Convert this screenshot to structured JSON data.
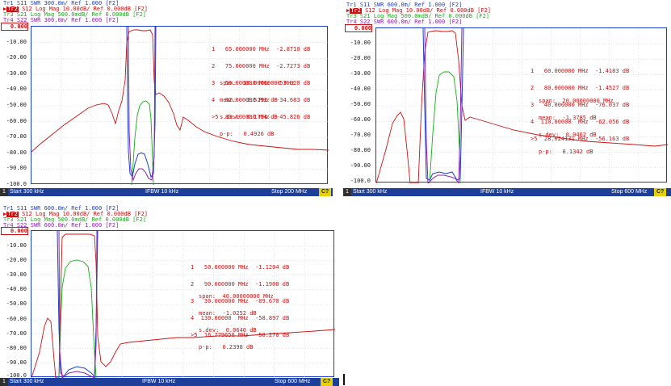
{
  "panels": [
    {
      "traces": [
        {
          "id": "Tr1",
          "text": "S11  SWR 300.0m/ Ref 1.000 [F2]",
          "color": "#1a3fd0",
          "selected": false
        },
        {
          "id": "Tr2",
          "text": "S12  Log Mag 10.00dB/ Ref 0.000dB [F2]",
          "color": "#d01010",
          "selected": true
        },
        {
          "id": "Tr3",
          "text": "S21  Log Mag 500.0mdB/ Ref 0.000dB [F2]",
          "color": "#10b010",
          "selected": false
        },
        {
          "id": "Tr4",
          "text": "S22  SWR 300.0m/ Ref 1.000 [F2]",
          "color": "#9020b0",
          "selected": false
        }
      ],
      "y_labels": [
        "0.000",
        "-10.00",
        "-20.00",
        "-30.00",
        "-40.00",
        "-50.00",
        "-60.00",
        "-70.00",
        "-80.00",
        "-90.00",
        "-100.0"
      ],
      "markers": [
        "1   65.000000 MHz  -2.8710 dB",
        "2   75.000000 MHz  -2.7273 dB",
        "3   56.000000 MHz  -53.020 dB",
        "4   82.000000 MHz  -34.683 dB",
        ">5  83.000000 MHz  -45.826 dB"
      ],
      "stats": [
        "span:  10.00000000 MHz",
        "mean:  -2.5292 dB",
        "s.dev:  0.1754 dB",
        "p-p:   0.4926 dB"
      ],
      "status": {
        "channel": "1",
        "start": "Start 300 kHz",
        "ifbw": "IFBW 10 kHz",
        "stop": "Stop 200 MHz",
        "c2": "C?"
      }
    },
    {
      "traces": [
        {
          "id": "Tr1",
          "text": "S11  SWR 600.0m/ Ref 1.000 [F2]",
          "color": "#1a3fd0",
          "selected": false
        },
        {
          "id": "Tr2",
          "text": "S12  Log Mag 10.00dB/ Ref 0.000dB [F2]",
          "color": "#d01010",
          "selected": true
        },
        {
          "id": "Tr3",
          "text": "S21  Log Mag 500.0mdB/ Ref 0.000dB [F2]",
          "color": "#10b010",
          "selected": false
        },
        {
          "id": "Tr4",
          "text": "S22  SWR 600.0m/ Ref 1.000 [F2]",
          "color": "#9020b0",
          "selected": false
        }
      ],
      "y_labels": [
        "0.000",
        "-10.00",
        "-20.00",
        "-30.00",
        "-40.00",
        "-50.00",
        "-60.00",
        "-70.00",
        "-80.00",
        "-90.00",
        "-100.0"
      ],
      "markers": [
        "1   60.000000 MHz  -1.4183 dB",
        "2   80.000000 MHz  -1.4527 dB",
        "3   40.000000 MHz  -76.037 dB",
        "4  110.00000  MHz  -62.056 dB",
        ">5  28.024131 MHz  -56.163 dB"
      ],
      "stats": [
        "span:  20.00000000 MHz",
        "mean:  -1.3785 dB",
        "s.dev:  0.0462 dB",
        "p-p:   0.1342 dB"
      ],
      "status": {
        "channel": "1",
        "start": "Start 300 kHz",
        "ifbw": "IFBW 10 kHz",
        "stop": "Stop 600 MHz",
        "c2": "C?"
      }
    },
    {
      "traces": [
        {
          "id": "Tr1",
          "text": "S11  SWR 600.0m/ Ref 1.000 [F2]",
          "color": "#1a3fd0",
          "selected": false
        },
        {
          "id": "Tr2",
          "text": "S12  Log Mag 10.00dB/ Ref 0.000dB [F2]",
          "color": "#d01010",
          "selected": true
        },
        {
          "id": "Tr3",
          "text": "S21  Log Mag 500.0mdB/ Ref 0.000dB [F2]",
          "color": "#10b010",
          "selected": false
        },
        {
          "id": "Tr4",
          "text": "S22  SWR 600.0m/ Ref 1.000 [F2]",
          "color": "#9020b0",
          "selected": false
        }
      ],
      "y_labels": [
        "0.000",
        "-10.00",
        "-20.00",
        "-30.00",
        "-40.00",
        "-50.00",
        "-60.00",
        "-70.00",
        "-80.00",
        "-90.00",
        "-100.0"
      ],
      "markers": [
        "1   50.000000 MHz  -1.1204 dB",
        "2   90.000000 MHz  -1.1900 dB",
        "3   30.000000 MHz  -89.670 dB",
        "4  130.00000  MHz  -58.897 dB",
        ">5  16.779656 MHz  -58.270 dB"
      ],
      "stats": [
        "span:  40.00000000 MHz",
        "mean:  -1.0252 dB",
        "s.dev:  0.0640 dB",
        "p-p:   0.2398 dB"
      ],
      "status": {
        "channel": "1",
        "start": "Start 300 kHz",
        "ifbw": "IFBW 10 kHz",
        "stop": "Stop 600 MHz",
        "c2": "C?"
      }
    }
  ]
}
